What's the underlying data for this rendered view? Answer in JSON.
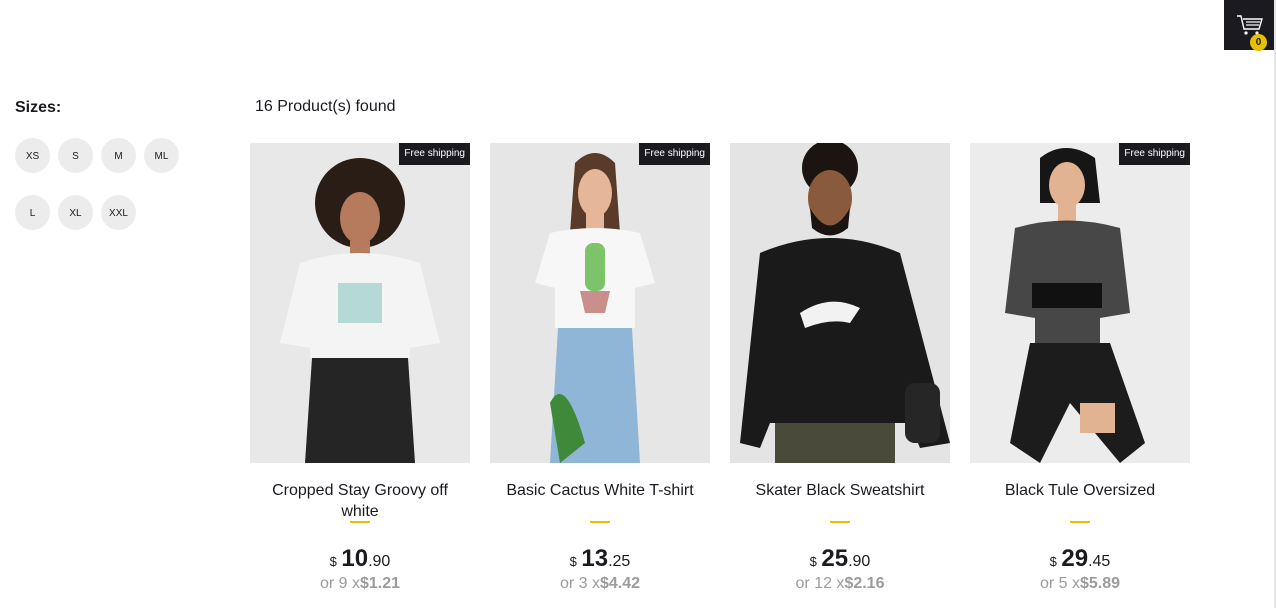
{
  "cart": {
    "count": "0"
  },
  "filters": {
    "title": "Sizes:",
    "sizes": [
      "XS",
      "S",
      "M",
      "ML",
      "L",
      "XL",
      "XXL"
    ]
  },
  "results": {
    "found_text": "16 Product(s) found"
  },
  "products": [
    {
      "name": "Cropped Stay Groovy off white",
      "free_shipping": "Free shipping",
      "currency": "$",
      "price_int": "10",
      "price_dec": ".90",
      "installment_prefix": "or 9 x",
      "installment_value": "$1.21",
      "palette": {
        "top": "#f4f4f4",
        "bottom": "#252525",
        "skin": "#b67a5c",
        "hair": "#2a1d16"
      }
    },
    {
      "name": "Basic Cactus White T-shirt",
      "free_shipping": "Free shipping",
      "currency": "$",
      "price_int": "13",
      "price_dec": ".25",
      "installment_prefix": "or 3 x",
      "installment_value": "$4.42",
      "palette": {
        "top": "#f7f7f7",
        "bottom": "#8fb6d6",
        "skin": "#e5b697",
        "hair": "#5a3a28"
      }
    },
    {
      "name": "Skater Black Sweatshirt",
      "free_shipping": "",
      "currency": "$",
      "price_int": "25",
      "price_dec": ".90",
      "installment_prefix": "or 12 x",
      "installment_value": "$2.16",
      "palette": {
        "top": "#1a1a1a",
        "bottom": "#4a4a3a",
        "skin": "#8a5a3c",
        "hair": "#1c1410"
      }
    },
    {
      "name": "Black Tule Oversized",
      "free_shipping": "Free shipping",
      "currency": "$",
      "price_int": "29",
      "price_dec": ".45",
      "installment_prefix": "or 5 x",
      "installment_value": "$5.89",
      "palette": {
        "top": "#2a2a2a",
        "bottom": "#1c1c1c",
        "skin": "#e2b393",
        "hair": "#161616"
      }
    }
  ],
  "colors": {
    "accent": "#eabf00",
    "dark": "#1b1a20",
    "muted": "#9c9b9b"
  }
}
